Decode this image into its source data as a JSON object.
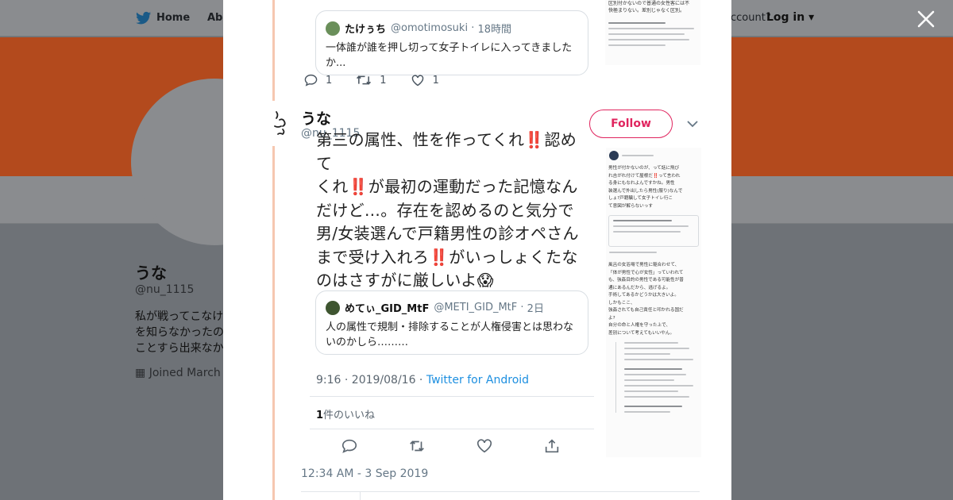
{
  "background": {
    "nav": {
      "home": "Home",
      "about": "Abo",
      "account": "ccount?",
      "login": "Log in"
    },
    "profile": {
      "name": "うな",
      "handle": "@nu_1115",
      "bio_lines": [
        "私が戦ってこなけ",
        "を知らなかったの",
        "ことすら出来なか"
      ],
      "joined": "Joined March"
    }
  },
  "colors": {
    "banner": "#b34a1d",
    "accent": "#e0245e",
    "link": "#1d8fe0",
    "thread": "#f6c7b0"
  },
  "top_tweet": {
    "quote": {
      "name": "たけぅち",
      "handle": "@omotimosuki",
      "time": "18時間",
      "text": "一体誰が誰を押し切って女子トイレに入ってきました か..."
    },
    "side_text": [
      "区別付かないので普通の女性客には不",
      "快極まりない。差別じゃなく区別。"
    ],
    "replies": "1",
    "retweets": "1",
    "likes": "1"
  },
  "tweet": {
    "name": "うな",
    "handle": "@nu_1115",
    "follow_label": "Follow",
    "screenshot": {
      "text_lines": [
        "第三の属性、性を作ってくれ‼️認めて",
        "くれ‼️が最初の運動だった記憶なん",
        "だけど…。存在を認めるのと気分で",
        "男/女装選んで戸籍男性の診オペさん",
        "まで受け入れろ‼️がいっしょくたな",
        "のはさすがに厳しいよ😱"
      ],
      "quote": {
        "name": "めてぃ_GID_MtF",
        "handle": "@METI_GID_MtF",
        "time": "2日",
        "text": "人の属性で規制・排除することが人権侵害とは思わな いのかしら………"
      },
      "time": "9:16 · 2019/08/16",
      "source": "Twitter for Android",
      "likes_count": "1",
      "likes_label": "件のいいね"
    },
    "side_screenshot": {
      "text_lines": [
        "男性が付かないのが、って話に飛び",
        "れ吉がれ付けて屋根だ‼️って言われ",
        "る身にもなれよんですかね。男性",
        "装選んで外出したら男性(服り)なんで",
        "しょ?戸籍騙して女子トイレ行こ",
        "て意図が解らないっす",
        "風呂の女浴場で男性に躯合わせて、",
        "「体が男性で心が女性」っていわれて",
        "も、強姦目的の男性である可能性が普",
        "通にあるんだから、逃げるよ。",
        "手術してあるかどうかは大きいよ。",
        "しかもここ、",
        "強姦されても自己責任と叩かれる国だ",
        "よ?",
        "自分の命と人権を守った上で、",
        "差別について考えてもいいやん。"
      ]
    },
    "timestamp": "12:34 AM - 3 Sep 2019"
  }
}
